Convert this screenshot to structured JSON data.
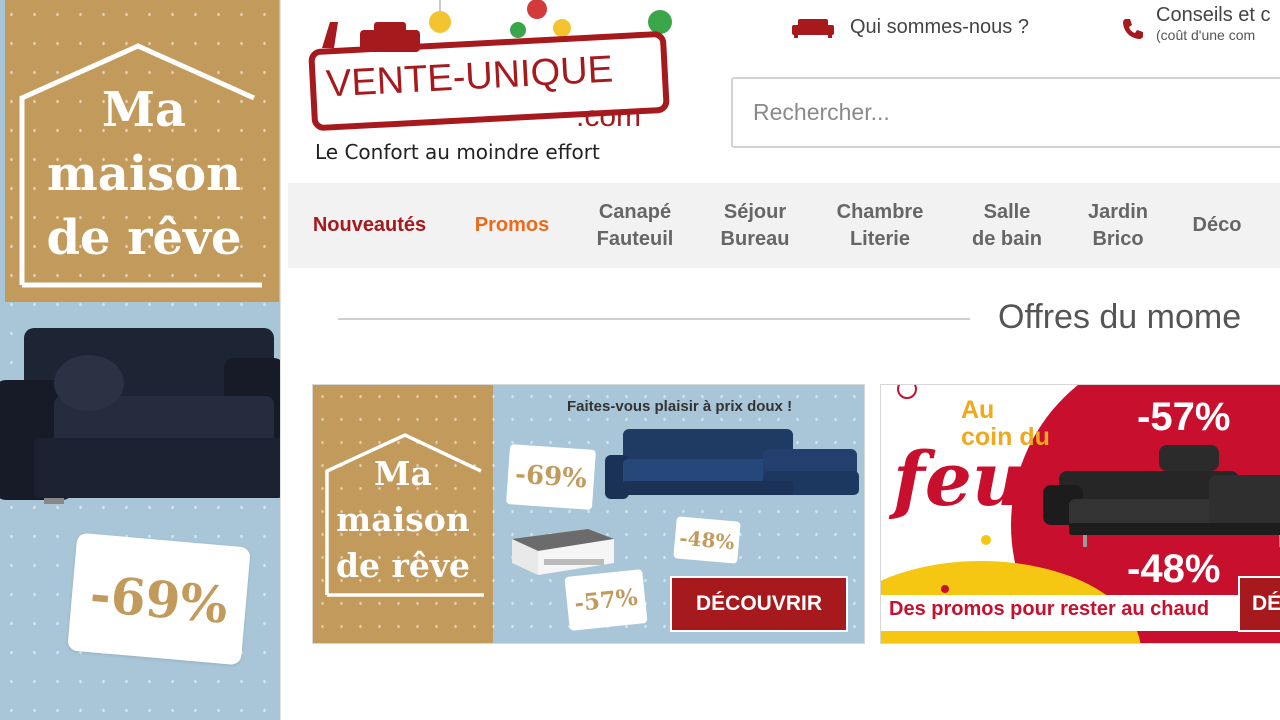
{
  "left_ad": {
    "slogan_line1": "Ma",
    "slogan_line2": "maison",
    "slogan_line3": "de rêve",
    "discount": "-69%"
  },
  "header": {
    "logo_name": "VENTE-UNIQUE",
    "logo_dotcom": ".com",
    "tagline": "Le Confort au moindre effort",
    "about_link": "Qui sommes-nous ?",
    "advice_title": "Conseils et c",
    "advice_subtitle": "(coût d'une com",
    "about_icon": "sofa-icon",
    "advice_icon": "phone-icon"
  },
  "search": {
    "placeholder": "Rechercher..."
  },
  "nav": {
    "items": [
      {
        "label": "Nouveautés"
      },
      {
        "label": "Promos"
      },
      {
        "line1": "Canapé",
        "line2": "Fauteuil"
      },
      {
        "line1": "Séjour",
        "line2": "Bureau"
      },
      {
        "line1": "Chambre",
        "line2": "Literie"
      },
      {
        "line1": "Salle",
        "line2": "de bain"
      },
      {
        "line1": "Jardin",
        "line2": "Brico"
      },
      {
        "label": "Déco"
      }
    ]
  },
  "section": {
    "title": "Offres du mome"
  },
  "banner1": {
    "headline": "Faites-vous plaisir à prix doux !",
    "slogan_line1": "Ma",
    "slogan_line2": "maison",
    "slogan_line3": "de rêve",
    "tag1": "-69%",
    "tag2": "-48%",
    "tag3": "-57%",
    "cta": "DÉCOUVRIR"
  },
  "banner2": {
    "au": "Au",
    "coin_du": "coin du",
    "feu": "feu",
    "discount1": "-57%",
    "discount2": "-48%",
    "bottom_text": "Des promos pour rester au chaud",
    "cta": "DÉ"
  },
  "colors": {
    "brand_red": "#a6191d",
    "promo_orange": "#ec6a1a",
    "gold": "#c29a5b",
    "sky_blue": "#a9c6d8"
  }
}
